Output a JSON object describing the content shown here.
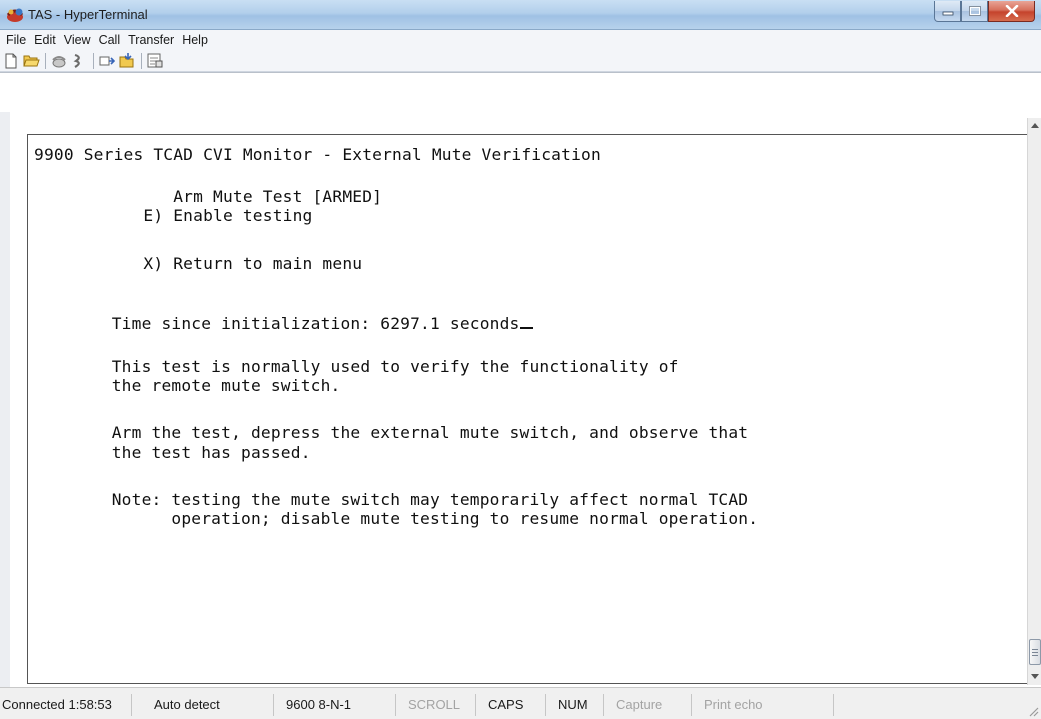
{
  "window": {
    "title": "TAS - HyperTerminal",
    "icon": "hyperterminal-phone-icon"
  },
  "menu": [
    "File",
    "Edit",
    "View",
    "Call",
    "Transfer",
    "Help"
  ],
  "toolbar": {
    "buttons": [
      "new-icon",
      "open-icon",
      "connect-icon",
      "disconnect-icon",
      "send-icon",
      "receive-icon",
      "properties-icon"
    ]
  },
  "terminal": {
    "lines": [
      "9900 Series TCAD CVI Monitor - External Mute Verification",
      "              Arm Mute Test [ARMED]",
      "           E) Enable testing",
      "           X) Return to main menu",
      "     Time since initialization: 6297.1 seconds",
      "     This test is normally used to verify the functionality of",
      "     the remote mute switch.",
      "     Arm the test, depress the external mute switch, and observe that",
      "     the test has passed.",
      "     Note: testing the mute switch may temporarily affect normal TCAD",
      "           operation; disable mute testing to resume normal operation."
    ]
  },
  "status": {
    "connected": "Connected 1:58:53",
    "detect": "Auto detect",
    "settings": "9600 8-N-1",
    "scroll": "SCROLL",
    "caps": "CAPS",
    "num": "NUM",
    "capture": "Capture",
    "print_echo": "Print echo"
  },
  "colors": {
    "titlebar": "#b2cfeb",
    "close_button": "#c5432c",
    "terminal_text": "#101010",
    "disabled_status": "#a3a3a3"
  }
}
